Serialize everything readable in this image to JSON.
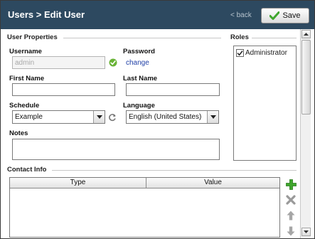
{
  "header": {
    "title": "Users > Edit User",
    "back_label": "< back",
    "save_label": "Save"
  },
  "user_properties": {
    "legend": "User Properties",
    "username_label": "Username",
    "username_value": "admin",
    "password_label": "Password",
    "password_link": "change",
    "first_name_label": "First Name",
    "first_name_value": "",
    "last_name_label": "Last Name",
    "last_name_value": "",
    "schedule_label": "Schedule",
    "schedule_value": "Example",
    "language_label": "Language",
    "language_value": "English (United States)",
    "notes_label": "Notes",
    "notes_value": ""
  },
  "roles": {
    "legend": "Roles",
    "items": [
      {
        "label": "Administrator",
        "checked": true
      }
    ]
  },
  "contact_info": {
    "legend": "Contact Info",
    "columns": [
      "Type",
      "Value"
    ],
    "rows": []
  },
  "colors": {
    "header_bg": "#2d4960",
    "accent_green": "#3fa62d",
    "link_blue": "#1f3fa6"
  },
  "icons": {
    "save": "check-icon",
    "username_valid": "check-circle-icon",
    "schedule_refresh": "refresh-icon",
    "add": "plus-icon",
    "delete": "x-icon",
    "move_up": "arrow-up-icon",
    "move_down": "arrow-down-icon"
  }
}
